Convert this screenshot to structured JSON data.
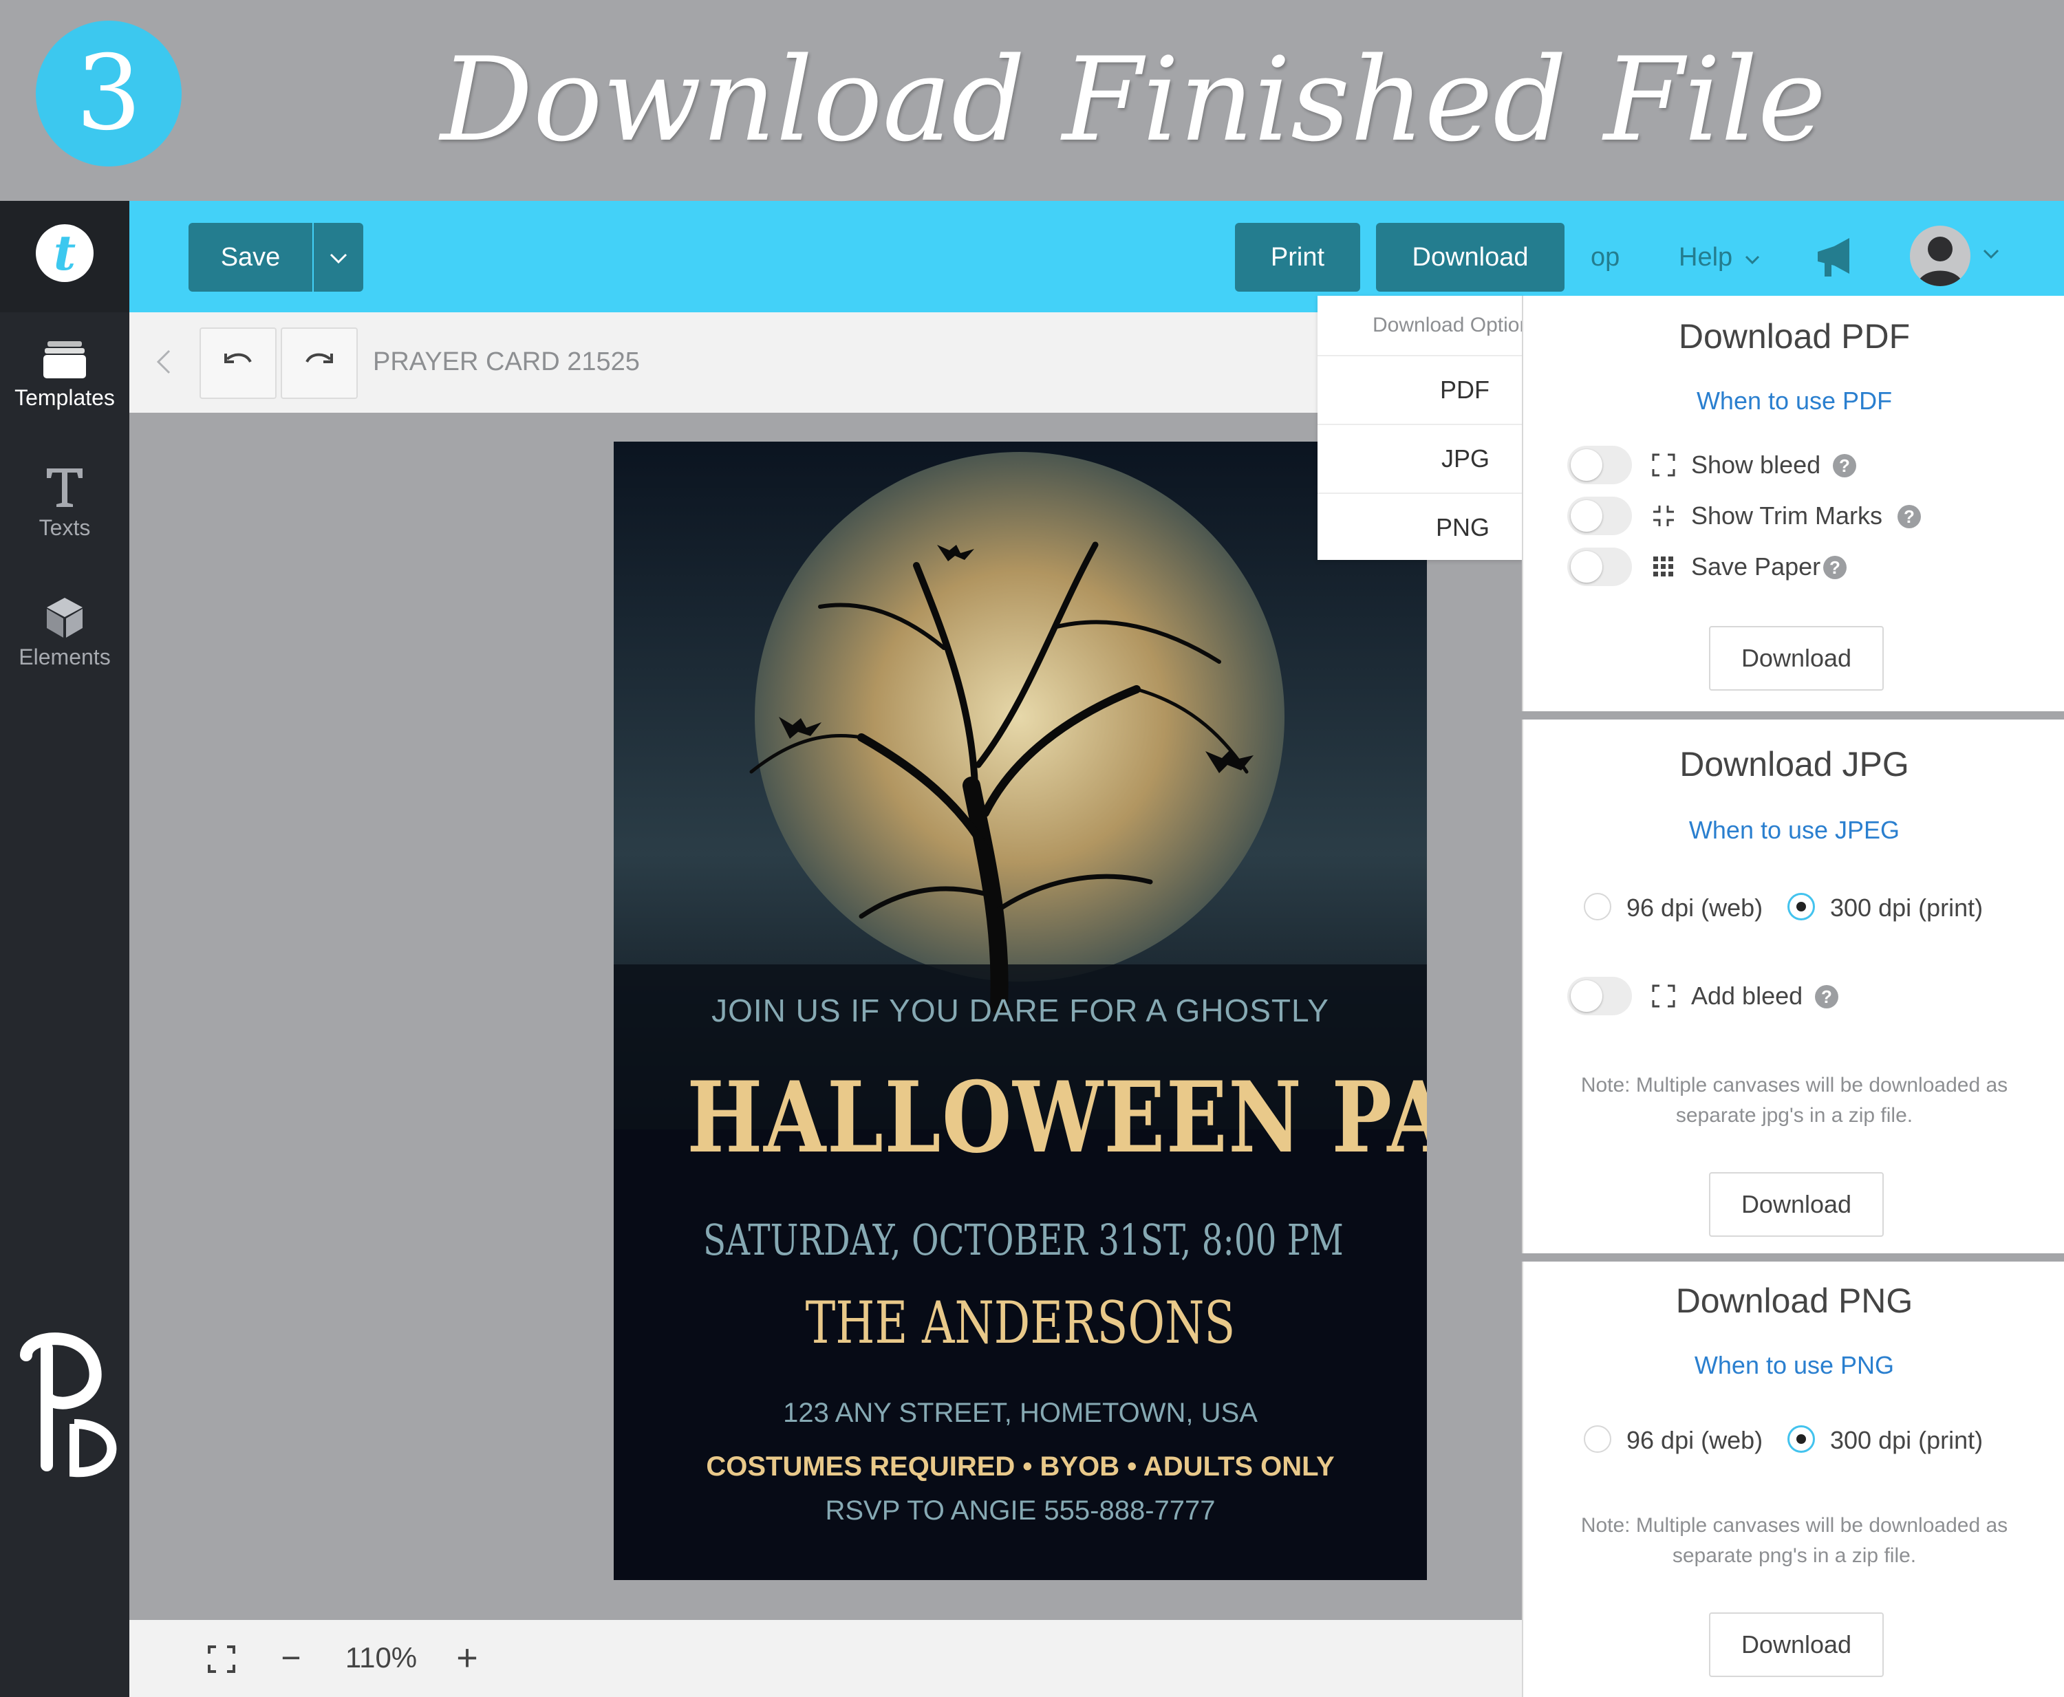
{
  "banner": {
    "step": "3",
    "title": "Download Finished File"
  },
  "sidebar": {
    "logo": "t",
    "items": [
      {
        "label": "Templates",
        "icon": "templates-icon"
      },
      {
        "label": "Texts",
        "icon": "text-icon"
      },
      {
        "label": "Elements",
        "icon": "cube-icon"
      }
    ]
  },
  "toolbar": {
    "save_label": "Save",
    "print_label": "Print",
    "download_label": "Download",
    "op_label": "op",
    "help_label": "Help",
    "accent": "#43d1f8",
    "button_color": "#247d8f"
  },
  "subbar": {
    "document_title": "PRAYER CARD 21525"
  },
  "zoom": {
    "level": "110%",
    "out": "−",
    "in": "+"
  },
  "card": {
    "line1": "JOIN US IF YOU DARE FOR A GHOSTLY",
    "title": "HALLOWEEN PARTY",
    "date": "SATURDAY, OCTOBER 31ST, 8:00 PM",
    "host": "THE ANDERSONS",
    "address": "123 ANY STREET, HOMETOWN, USA",
    "notes": "COSTUMES REQUIRED • BYOB • ADULTS ONLY",
    "rsvp": "RSVP TO ANGIE 555-888-7777"
  },
  "download_menu": {
    "header": "Download Options",
    "options": [
      "PDF",
      "JPG",
      "PNG"
    ]
  },
  "panels": {
    "pdf": {
      "title": "Download PDF",
      "link": "When to use PDF",
      "toggles": [
        {
          "label": "Show bleed",
          "on": false
        },
        {
          "label": "Show Trim Marks",
          "on": false
        },
        {
          "label": "Save Paper",
          "on": false
        }
      ],
      "button": "Download"
    },
    "jpg": {
      "title": "Download JPG",
      "link": "When to use JPEG",
      "radio_web": "96 dpi (web)",
      "radio_print": "300 dpi (print)",
      "selected": "300 dpi (print)",
      "toggle_label": "Add bleed",
      "note": "Note: Multiple canvases will be downloaded as separate jpg's in a zip file.",
      "button": "Download"
    },
    "png": {
      "title": "Download PNG",
      "link": "When to use PNG",
      "radio_web": "96 dpi (web)",
      "radio_print": "300 dpi (print)",
      "selected": "300 dpi (print)",
      "note": "Note: Multiple canvases will be downloaded as separate png's in a zip file.",
      "button": "Download"
    }
  }
}
